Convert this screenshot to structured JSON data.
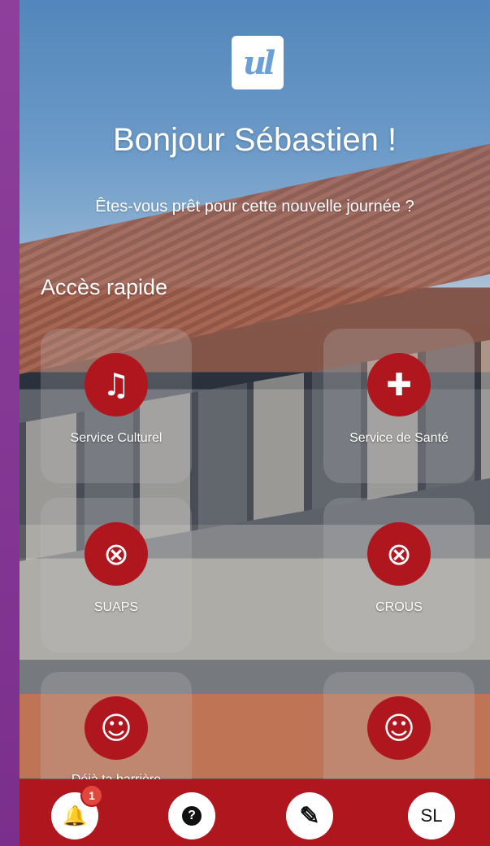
{
  "logo_text": "ul",
  "greeting": "Bonjour Sébastien !",
  "subtitle": "Êtes-vous prêt pour cette nouvelle journée ?",
  "quick_access": {
    "title": "Accès rapide",
    "tiles": [
      {
        "label": "Service Culturel",
        "icon": "music-note-icon",
        "glyph": "♫"
      },
      {
        "label": "Service de Santé",
        "icon": "medical-kit-icon",
        "glyph": "✚"
      },
      {
        "label": "SUAPS",
        "icon": "basketball-icon",
        "glyph": "⊗"
      },
      {
        "label": "CROUS",
        "icon": "basketball-icon",
        "glyph": "⊗"
      },
      {
        "label": "Déjà ta barrière",
        "icon": "smiley-icon",
        "glyph": "☺"
      },
      {
        "label": "",
        "icon": "smiley-icon",
        "glyph": "☺"
      }
    ]
  },
  "bottom_nav": {
    "notifications": {
      "icon": "bell-icon",
      "glyph": "🔔",
      "badge": "1"
    },
    "help": {
      "icon": "help-icon",
      "glyph": "?"
    },
    "edit": {
      "icon": "pencil-icon",
      "glyph": "✎"
    },
    "profile": {
      "initials": "SL"
    }
  },
  "colors": {
    "accent": "#b0161e",
    "side_purple": "#7b2f8c"
  }
}
